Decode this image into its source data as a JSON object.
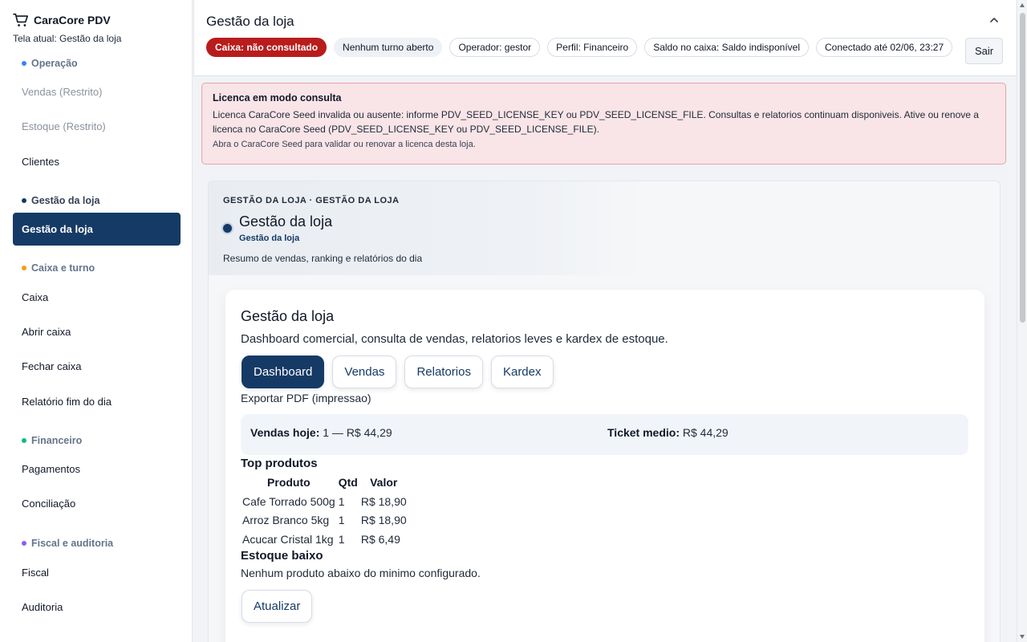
{
  "app": {
    "name": "CaraCore PDV",
    "current_screen": "Tela atual: Gestão da loja"
  },
  "sidebar": {
    "sections": [
      {
        "label": "Operação",
        "color": "#3b82f6"
      },
      {
        "label": "Gestão da loja",
        "color": "#163a66"
      },
      {
        "label": "Caixa e turno",
        "color": "#f59e0b"
      },
      {
        "label": "Financeiro",
        "color": "#10b981"
      },
      {
        "label": "Fiscal e auditoria",
        "color": "#8b5cf6"
      }
    ],
    "items": [
      {
        "label": "Vendas (Restrito)"
      },
      {
        "label": "Estoque (Restrito)"
      },
      {
        "label": "Clientes"
      },
      {
        "label": "Gestão da loja"
      },
      {
        "label": "Caixa"
      },
      {
        "label": "Abrir caixa"
      },
      {
        "label": "Fechar caixa"
      },
      {
        "label": "Relatório fim do dia"
      },
      {
        "label": "Pagamentos"
      },
      {
        "label": "Conciliação"
      },
      {
        "label": "Fiscal"
      },
      {
        "label": "Auditoria"
      }
    ]
  },
  "header": {
    "title": "Gestão da loja",
    "chips": [
      "Caixa: não consultado",
      "Nenhum turno aberto",
      "Operador: gestor",
      "Perfil: Financeiro",
      "Saldo no caixa: Saldo indisponível",
      "Conectado até 02/06, 23:27"
    ],
    "logout_label": "Sair"
  },
  "alert": {
    "title": "Licenca em modo consulta",
    "text": "Licenca CaraCore Seed invalida ou ausente: informe PDV_SEED_LICENSE_KEY ou PDV_SEED_LICENSE_FILE. Consultas e relatorios continuam disponiveis. Ative ou renove a licenca no CaraCore Seed (PDV_SEED_LICENSE_KEY ou PDV_SEED_LICENSE_FILE).",
    "hint": "Abra o CaraCore Seed para validar ou renovar a licenca desta loja."
  },
  "panel": {
    "eyebrow": "GESTÃO DA LOJA · GESTÃO DA LOJA",
    "title": "Gestão da loja",
    "subtitle": "Gestão da loja",
    "description": "Resumo de vendas, ranking e relatórios do dia"
  },
  "card": {
    "title": "Gestão da loja",
    "description": "Dashboard comercial, consulta de vendas, relatorios leves e kardex de estoque.",
    "tabs": [
      "Dashboard",
      "Vendas",
      "Relatorios",
      "Kardex"
    ],
    "export_label": "Exportar PDF (impressao)",
    "stats": {
      "sales_label": "Vendas hoje:",
      "sales_value": "1 — R$ 44,29",
      "ticket_label": "Ticket medio:",
      "ticket_value": "R$ 44,29"
    },
    "top_title": "Top produtos",
    "table": {
      "headers": [
        "Produto",
        "Qtd",
        "Valor"
      ],
      "rows": [
        [
          "Cafe Torrado 500g",
          "1",
          "R$ 18,90"
        ],
        [
          "Arroz Branco 5kg",
          "1",
          "R$ 18,90"
        ],
        [
          "Acucar Cristal 1kg",
          "1",
          "R$ 6,49"
        ]
      ]
    },
    "low_stock_title": "Estoque baixo",
    "low_stock_text": "Nenhum produto abaixo do minimo configurado.",
    "refresh_label": "Atualizar"
  }
}
